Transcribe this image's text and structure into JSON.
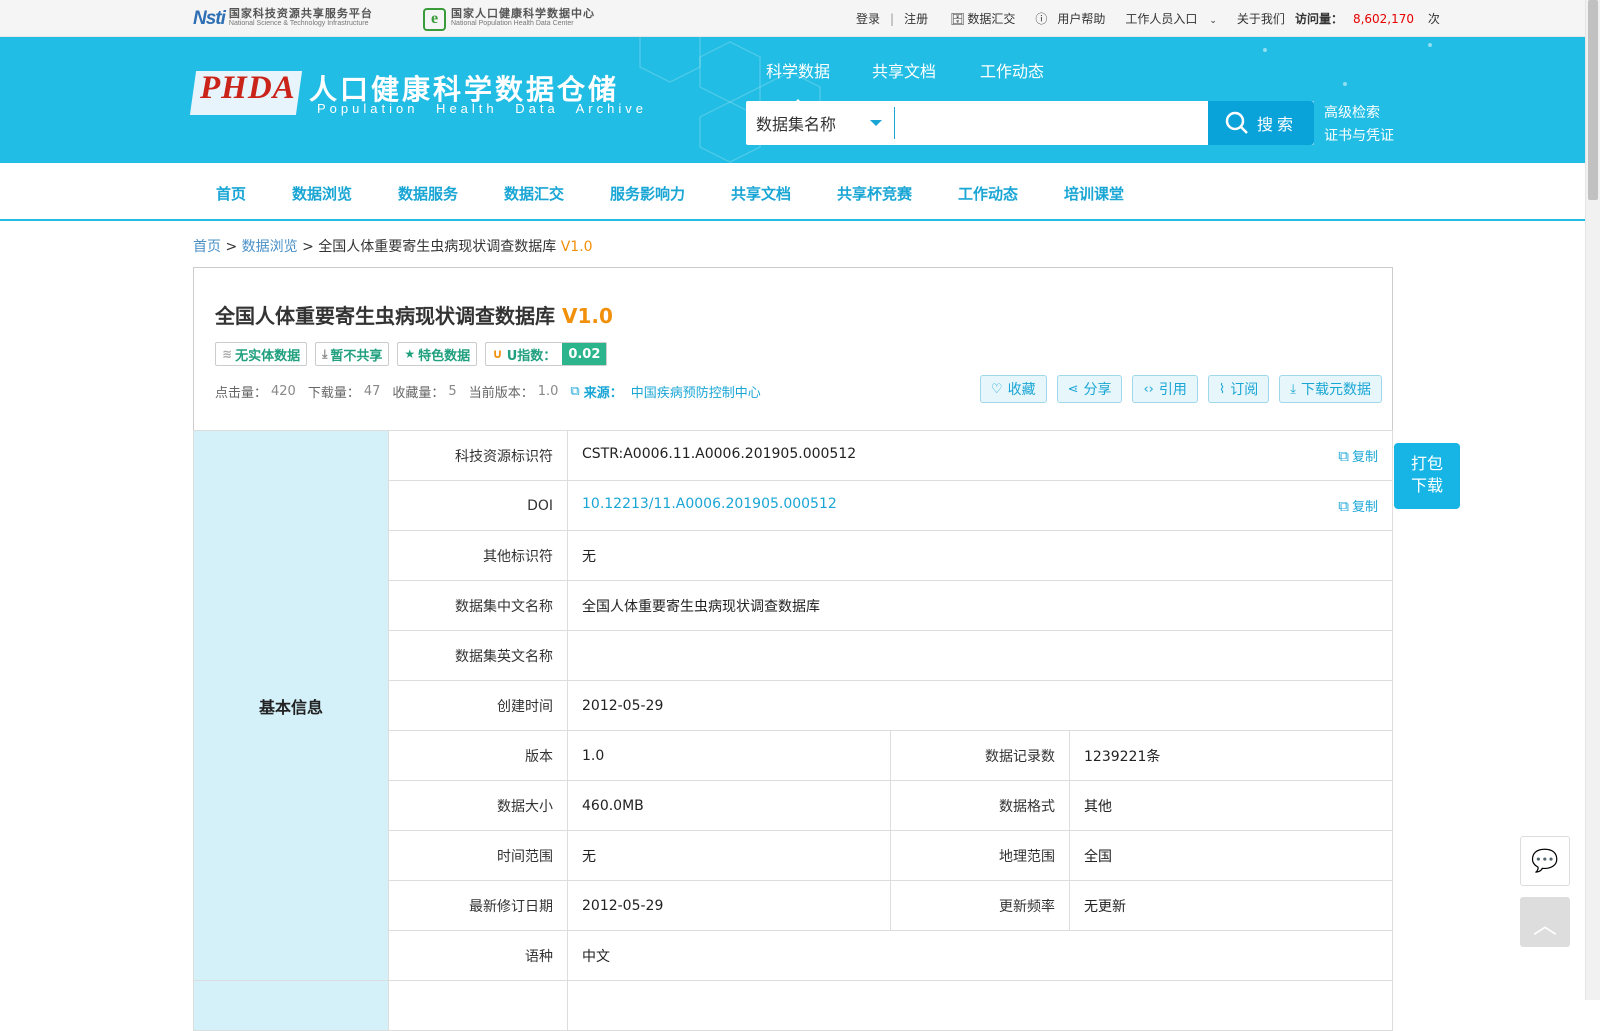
{
  "top": {
    "logo1_cn": "国家科技资源共享服务平台",
    "logo1_en": "National Science & Technology Infrastructure",
    "logo2_cn": "国家人口健康科学数据中心",
    "logo2_en": "National Population Health Data Center",
    "login": "登录",
    "separator": "|",
    "register": "注册",
    "data_submit": "数据汇交",
    "help": "用户帮助",
    "staff": "工作人员入口",
    "about": "关于我们",
    "visit_label": "访问量：",
    "visit_count": "8,602,170",
    "visit_unit": "次"
  },
  "banner": {
    "phda": "PHDA",
    "title_cn": "人口健康科学数据仓储",
    "title_en": "Population Health Data Archive",
    "tabs": [
      "科学数据",
      "共享文档",
      "工作动态"
    ],
    "search_type": "数据集名称",
    "search_value": "",
    "search_button": "搜索",
    "advanced": "高级检索",
    "certificate": "证书与凭证"
  },
  "nav": [
    "首页",
    "数据浏览",
    "数据服务",
    "数据汇交",
    "服务影响力",
    "共享文档",
    "共享杯竞赛",
    "工作动态",
    "培训课堂"
  ],
  "breadcrumb": {
    "home": "首页",
    "sep": ">",
    "browse": "数据浏览",
    "current": "全国人体重要寄生虫病现状调查数据库",
    "version": "V1.0"
  },
  "dataset": {
    "title": "全国人体重要寄生虫病现状调查数据库",
    "version": "V1.0",
    "tags": [
      "无实体数据",
      "暂不共享",
      "特色数据"
    ],
    "u_index_label": "U指数：",
    "u_index_value": "0.02",
    "stats": {
      "clicks_label": "点击量：",
      "clicks": "420",
      "downloads_label": "下载量：",
      "downloads": "47",
      "favorites_label": "收藏量：",
      "favorites": "5",
      "current_version_label": "当前版本：",
      "current_version": "1.0",
      "source_label": "来源：",
      "source": "中国疾病预防控制中心"
    },
    "actions": [
      "收藏",
      "分享",
      "引用",
      "订阅",
      "下载元数据"
    ]
  },
  "info": {
    "section": "基本信息",
    "copy": "复制",
    "rows": [
      {
        "label": "科技资源标识符",
        "value": "CSTR:A0006.11.A0006.201905.000512"
      },
      {
        "label": "DOI",
        "value": "10.12213/11.A0006.201905.000512"
      },
      {
        "label": "其他标识符",
        "value": "无"
      },
      {
        "label": "数据集中文名称",
        "value": "全国人体重要寄生虫病现状调查数据库"
      },
      {
        "label": "数据集英文名称",
        "value": ""
      },
      {
        "label": "创建时间",
        "value": "2012-05-29"
      }
    ],
    "pairs": [
      {
        "l1": "版本",
        "v1": "1.0",
        "l2": "数据记录数",
        "v2": "1239221条"
      },
      {
        "l1": "数据大小",
        "v1": "460.0MB",
        "l2": "数据格式",
        "v2": "其他"
      },
      {
        "l1": "时间范围",
        "v1": "无",
        "l2": "地理范围",
        "v2": "全国"
      },
      {
        "l1": "最新修订日期",
        "v1": "2012-05-29",
        "l2": "更新频率",
        "v2": "无更新"
      }
    ],
    "language_label": "语种",
    "language": "中文"
  },
  "float": {
    "pack_download_1": "打包",
    "pack_download_2": "下载"
  },
  "colors": {
    "accent": "#21bde4",
    "orange": "#f0900b",
    "green": "#21a07f"
  }
}
